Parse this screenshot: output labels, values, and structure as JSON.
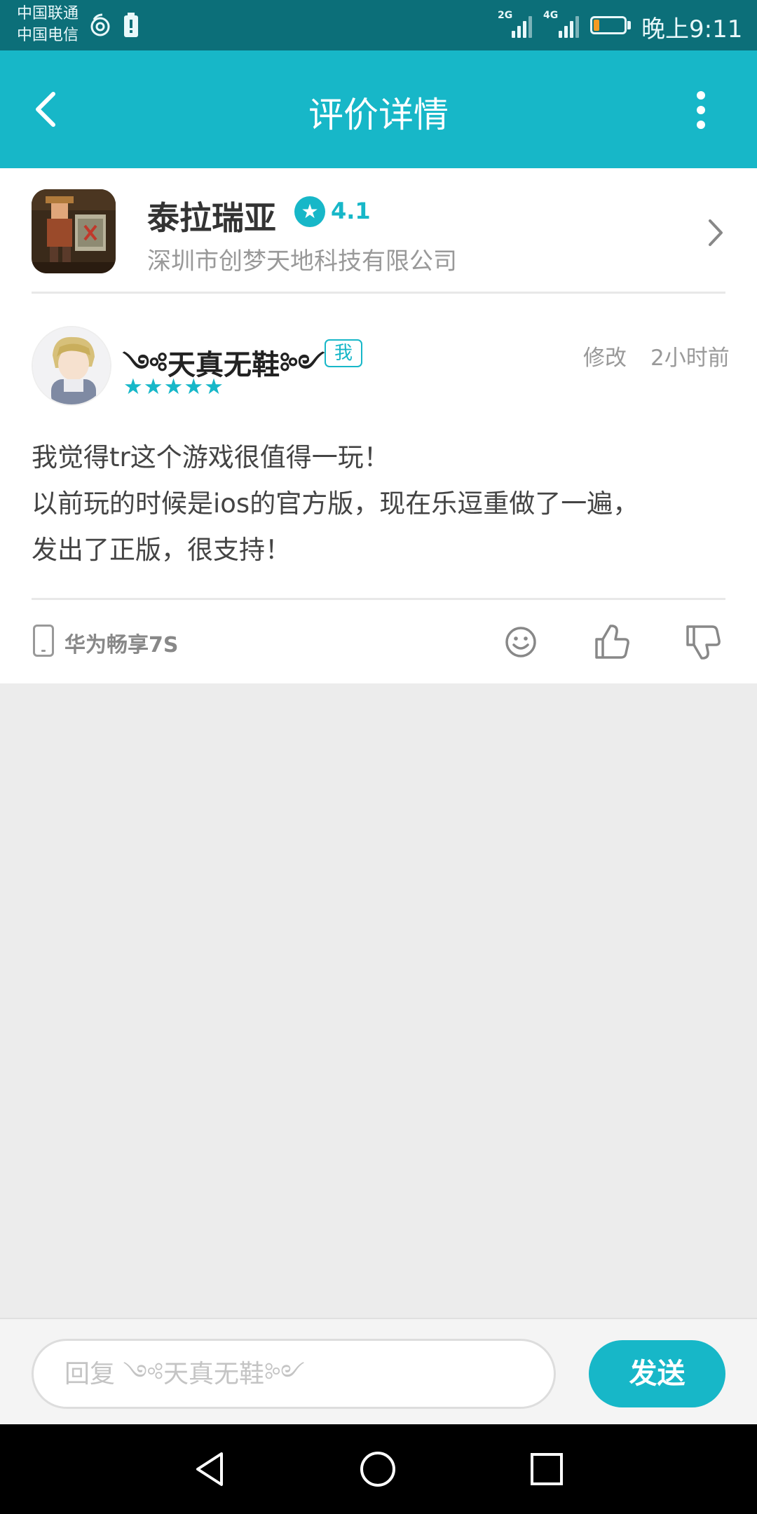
{
  "status_bar": {
    "carrier_1": "中国联通",
    "carrier_2": "中国电信",
    "signal_1_tag": "2G",
    "signal_2_tag": "4G",
    "battery_level": 0.2,
    "time": "晚上9:11"
  },
  "header": {
    "back_icon": "chevron-left-icon",
    "title": "评价详情",
    "more_icon": "more-vertical-icon"
  },
  "app": {
    "name": "泰拉瑞亚",
    "rating": "4.1",
    "developer": "深圳市创梦天地科技有限公司"
  },
  "review": {
    "username": "༺天真无鞋༻",
    "me_badge": "我",
    "edit_label": "修改",
    "time": "2小时前",
    "stars": "★★★★★",
    "star_count": 5,
    "lines": [
      "我觉得tr这个游戏很值得一玩！",
      "以前玩的时候是ios的官方版，现在乐逗重做了一遍，",
      "发出了正版，很支持！"
    ],
    "device": "华为畅享7S"
  },
  "reply": {
    "placeholder": "回复 ༺天真无鞋༻",
    "value": "",
    "send_label": "发送"
  },
  "colors": {
    "accent": "#17b7c8",
    "status_bar": "#0c6f79",
    "background": "#ececec"
  }
}
